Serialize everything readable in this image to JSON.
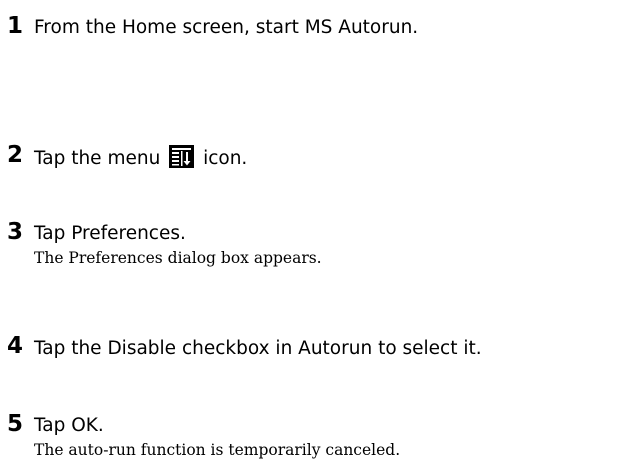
{
  "steps": [
    {
      "number": "1",
      "text": "From the Home screen, start MS Autorun."
    },
    {
      "number": "2",
      "text_before": "Tap the menu",
      "text_after": "icon.",
      "icon": "menu-icon"
    },
    {
      "number": "3",
      "text": "Tap Preferences.",
      "result": "The Preferences dialog box appears."
    },
    {
      "number": "4",
      "text": "Tap the Disable checkbox in Autorun to select it."
    },
    {
      "number": "5",
      "text": "Tap OK.",
      "result": "The auto-run function is temporarily canceled."
    }
  ]
}
